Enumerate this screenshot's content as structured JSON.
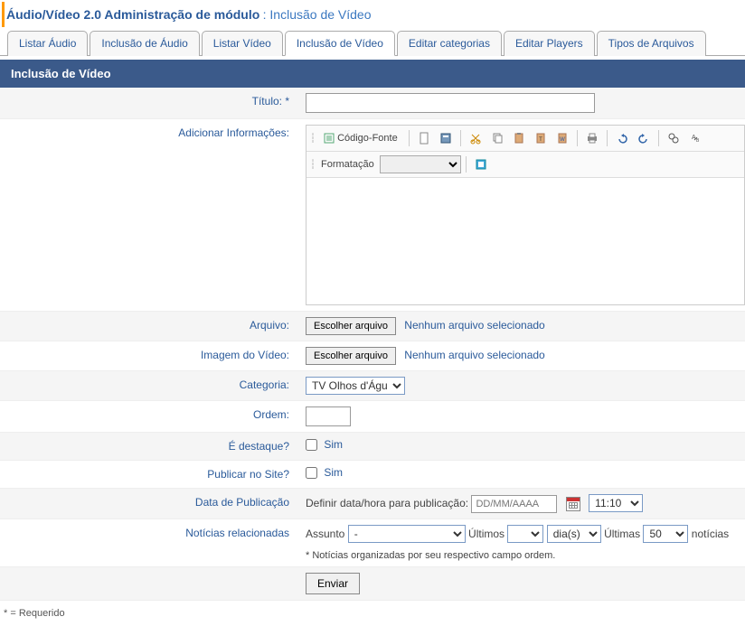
{
  "header": {
    "title": "Áudio/Vídeo 2.0 Administração de módulo",
    "subtitle": ": Inclusão de Vídeo"
  },
  "tabs": [
    {
      "label": "Listar Áudio",
      "active": false
    },
    {
      "label": "Inclusão de Áudio",
      "active": false
    },
    {
      "label": "Listar Vídeo",
      "active": false
    },
    {
      "label": "Inclusão de Vídeo",
      "active": true
    },
    {
      "label": "Editar categorias",
      "active": false
    },
    {
      "label": "Editar Players",
      "active": false
    },
    {
      "label": "Tipos de Arquivos",
      "active": false
    }
  ],
  "panel_title": "Inclusão de Vídeo",
  "labels": {
    "titulo": "Título: *",
    "info": "Adicionar Informações:",
    "arquivo": "Arquivo:",
    "imagem": "Imagem do Vídeo:",
    "categoria": "Categoria:",
    "ordem": "Ordem:",
    "destaque": "É destaque?",
    "publicar": "Publicar no Site?",
    "data_pub": "Data de Publicação",
    "noticias": "Notícias relacionadas"
  },
  "editor": {
    "source_btn": "Código-Fonte",
    "format_label": "Formatação"
  },
  "file": {
    "choose": "Escolher arquivo",
    "none": "Nenhum arquivo selecionado"
  },
  "categoria_value": "TV Olhos d'Água",
  "sim": "Sim",
  "datapub": {
    "prefix": "Definir data/hora para publicação:",
    "placeholder": "DD/MM/AAAA",
    "time": "11:10"
  },
  "noticias": {
    "assunto_label": "Assunto",
    "assunto_value": "-",
    "ultimos": "Últimos",
    "unit": "dia(s)",
    "ultimas": "Últimas",
    "count": "50",
    "noticias_word": "notícias",
    "note": "* Notícias organizadas por seu respectivo campo ordem."
  },
  "submit": "Enviar",
  "required_note": "* = Requerido"
}
